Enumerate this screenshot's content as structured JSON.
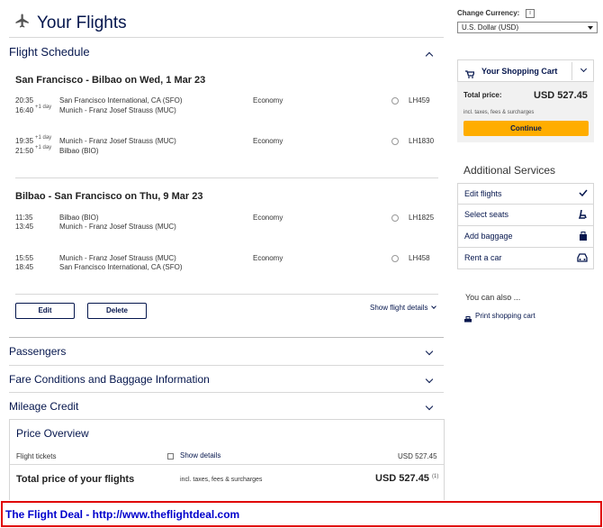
{
  "header": {
    "title": "Your Flights"
  },
  "schedule": {
    "section_title": "Flight Schedule",
    "outbound": {
      "heading": "San Francisco - Bilbao on Wed, 1 Mar 23",
      "segments": [
        {
          "dep_time": "20:35",
          "arr_time": "16:40",
          "arr_day": "+1 day",
          "dep_day": "",
          "from": "San Francisco International, CA (SFO)",
          "to": "Munich - Franz Josef Strauss (MUC)",
          "cabin": "Economy",
          "flight": "LH459"
        },
        {
          "dep_time": "19:35",
          "dep_day": "+1 day",
          "arr_time": "21:50",
          "arr_day": "+1 day",
          "from": "Munich - Franz Josef Strauss (MUC)",
          "to": "Bilbao (BIO)",
          "cabin": "Economy",
          "flight": "LH1830"
        }
      ]
    },
    "inbound": {
      "heading": "Bilbao - San Francisco on Thu, 9 Mar 23",
      "segments": [
        {
          "dep_time": "11:35",
          "arr_time": "13:45",
          "from": "Bilbao (BIO)",
          "to": "Munich - Franz Josef Strauss (MUC)",
          "cabin": "Economy",
          "flight": "LH1825"
        },
        {
          "dep_time": "15:55",
          "arr_time": "18:45",
          "from": "Munich - Franz Josef Strauss (MUC)",
          "to": "San Francisco International, CA (SFO)",
          "cabin": "Economy",
          "flight": "LH458"
        }
      ]
    },
    "edit_label": "Edit",
    "delete_label": "Delete",
    "show_details_label": "Show flight details"
  },
  "sections": {
    "passengers": "Passengers",
    "fare": "Fare Conditions and Baggage Information",
    "mileage": "Mileage Credit"
  },
  "price_overview": {
    "title": "Price Overview",
    "tickets_label": "Flight tickets",
    "show_details": "Show details",
    "tickets_amount": "USD 527.45",
    "total_label": "Total price of your flights",
    "incl_label": "incl. taxes, fees & surcharges",
    "total_amount": "USD 527.45",
    "footnote": "(1)"
  },
  "sidebar": {
    "currency_label": "Change Currency:",
    "currency_info": "i",
    "currency_value": "U.S. Dollar (USD)",
    "cart_title": "Your Shopping Cart",
    "total_label": "Total price:",
    "total_value": "USD 527.45",
    "incl_label": "incl. taxes, fees & surcharges",
    "continue_label": "Continue",
    "additional_title": "Additional Services",
    "services": [
      "Edit flights",
      "Select seats",
      "Add baggage",
      "Rent a car"
    ],
    "also_label": "You can also ...",
    "print_label": "Print shopping cart"
  },
  "footer": {
    "text": "The Flight Deal - http://www.theflightdeal.com"
  },
  "colors": {
    "navy": "#05164d",
    "continue": "#ffad00",
    "footer_border": "#e00000",
    "footer_text": "#0000cc"
  }
}
